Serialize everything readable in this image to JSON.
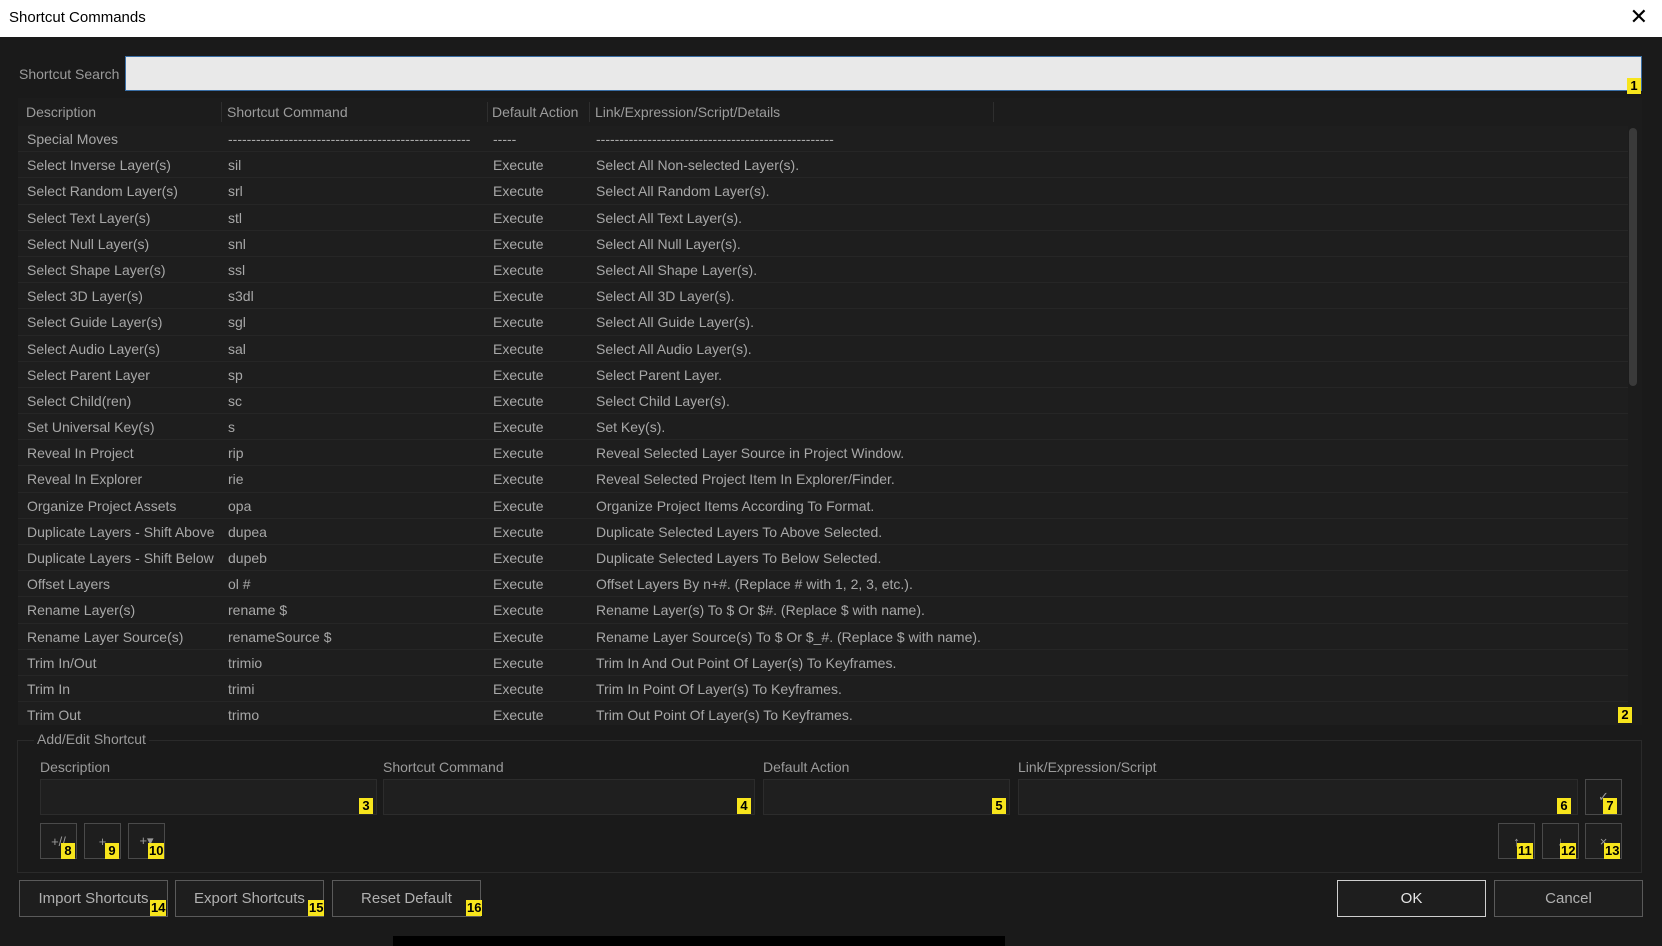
{
  "window": {
    "title": "Shortcut Commands",
    "close_glyph": "✕"
  },
  "search": {
    "label": "Shortcut Search",
    "value": "",
    "placeholder": ""
  },
  "table": {
    "headers": [
      "Description",
      "Shortcut Command",
      "Default Action",
      "Link/Expression/Script/Details"
    ],
    "rows": [
      [
        "Special Moves",
        "----------------------------------------------------",
        "-----",
        "---------------------------------------------------"
      ],
      [
        "Select Inverse Layer(s)",
        "sil",
        "Execute",
        "Select All Non-selected Layer(s)."
      ],
      [
        "Select Random Layer(s)",
        "srl",
        "Execute",
        "Select All Random Layer(s)."
      ],
      [
        "Select Text Layer(s)",
        "stl",
        "Execute",
        "Select All Text Layer(s)."
      ],
      [
        "Select Null Layer(s)",
        "snl",
        "Execute",
        "Select All Null Layer(s)."
      ],
      [
        "Select Shape Layer(s)",
        "ssl",
        "Execute",
        "Select All Shape Layer(s)."
      ],
      [
        "Select 3D Layer(s)",
        "s3dl",
        "Execute",
        "Select All 3D Layer(s)."
      ],
      [
        "Select Guide Layer(s)",
        "sgl",
        "Execute",
        "Select All Guide Layer(s)."
      ],
      [
        "Select Audio Layer(s)",
        "sal",
        "Execute",
        "Select All Audio Layer(s)."
      ],
      [
        "Select Parent Layer",
        "sp",
        "Execute",
        "Select Parent Layer."
      ],
      [
        "Select Child(ren)",
        "sc",
        "Execute",
        "Select Child Layer(s)."
      ],
      [
        "Set Universal Key(s)",
        "s",
        "Execute",
        "Set Key(s)."
      ],
      [
        "Reveal In Project",
        "rip",
        "Execute",
        "Reveal Selected Layer Source in Project Window."
      ],
      [
        "Reveal In Explorer",
        "rie",
        "Execute",
        "Reveal Selected Project Item In Explorer/Finder."
      ],
      [
        "Organize Project Assets",
        "opa",
        "Execute",
        "Organize Project Items According To Format."
      ],
      [
        "Duplicate Layers - Shift Above",
        "dupea",
        "Execute",
        "Duplicate Selected Layers To Above Selected."
      ],
      [
        "Duplicate Layers - Shift Below",
        "dupeb",
        "Execute",
        "Duplicate Selected Layers To Below Selected."
      ],
      [
        "Offset Layers",
        "ol #",
        "Execute",
        "Offset Layers By n+#. (Replace # with 1, 2, 3, etc.)."
      ],
      [
        "Rename Layer(s)",
        "rename $",
        "Execute",
        "Rename Layer(s) To $ Or $#. (Replace $ with name)."
      ],
      [
        "Rename Layer Source(s)",
        "renameSource $",
        "Execute",
        "Rename Layer Source(s) To $ Or $_#. (Replace $ with name)."
      ],
      [
        "Trim In/Out",
        "trimio",
        "Execute",
        "Trim In And Out Point Of Layer(s) To Keyframes."
      ],
      [
        "Trim In",
        "trimi",
        "Execute",
        "Trim In Point Of Layer(s) To Keyframes."
      ],
      [
        "Trim Out",
        "trimo",
        "Execute",
        "Trim Out Point Of Layer(s) To Keyframes."
      ]
    ]
  },
  "edit": {
    "group_label": "Add/Edit Shortcut",
    "labels": {
      "description": "Description",
      "command": "Shortcut Command",
      "action": "Default Action",
      "link": "Link/Expression/Script"
    },
    "values": {
      "description": "",
      "command": "",
      "action": "",
      "link": ""
    },
    "buttons": {
      "confirm": "✓",
      "add_separator": "+//",
      "add": "+",
      "add_menu": "+▾",
      "move_up": "↑",
      "move_down": "↓",
      "remove": "×"
    }
  },
  "footer": {
    "import": "Import Shortcuts",
    "export": "Export Shortcuts",
    "reset": "Reset Default",
    "ok": "OK",
    "cancel": "Cancel"
  },
  "badges": [
    "1",
    "2",
    "3",
    "4",
    "5",
    "6",
    "7",
    "8",
    "9",
    "10",
    "11",
    "12",
    "13",
    "14",
    "15",
    "16"
  ],
  "colors": {
    "background": "#1a1a1a",
    "badge": "#f7e51c",
    "search_focus": "#3a6ea5"
  }
}
